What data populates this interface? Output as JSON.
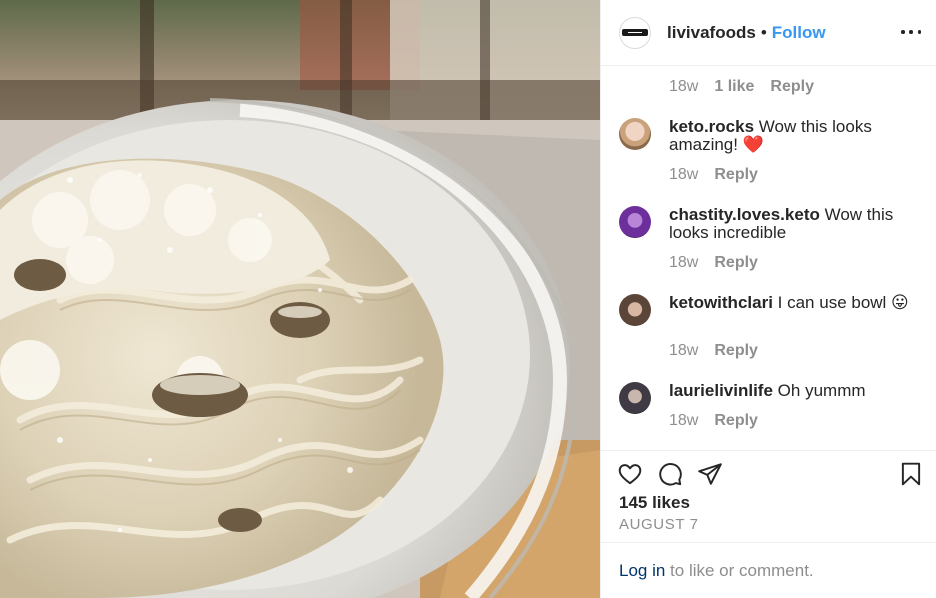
{
  "post": {
    "username": "livivafoods",
    "separator": "•",
    "follow_label": "Follow",
    "more_label": "More options"
  },
  "top_meta": {
    "time": "18w",
    "likes": "1 like",
    "reply": "Reply"
  },
  "comments": [
    {
      "username": "keto.rocks",
      "text": "Wow this looks amazing! ❤️",
      "time": "18w",
      "reply": "Reply"
    },
    {
      "username": "chastity.loves.keto",
      "text": "Wow this looks incredible",
      "time": "18w",
      "reply": "Reply"
    },
    {
      "username": "ketowithclari",
      "text": "I can use bowl 😛",
      "time": "18w",
      "reply": "Reply"
    },
    {
      "username": "laurielivinlife",
      "text": "Oh yummm",
      "time": "18w",
      "reply": "Reply"
    }
  ],
  "stats": {
    "likes": "145 likes",
    "date": "AUGUST 7"
  },
  "footer": {
    "login_link": "Log in",
    "login_rest": " to like or comment."
  },
  "icons": {
    "like": "heart-icon",
    "comment": "comment-bubble-icon",
    "share": "send-icon",
    "save": "bookmark-icon"
  }
}
